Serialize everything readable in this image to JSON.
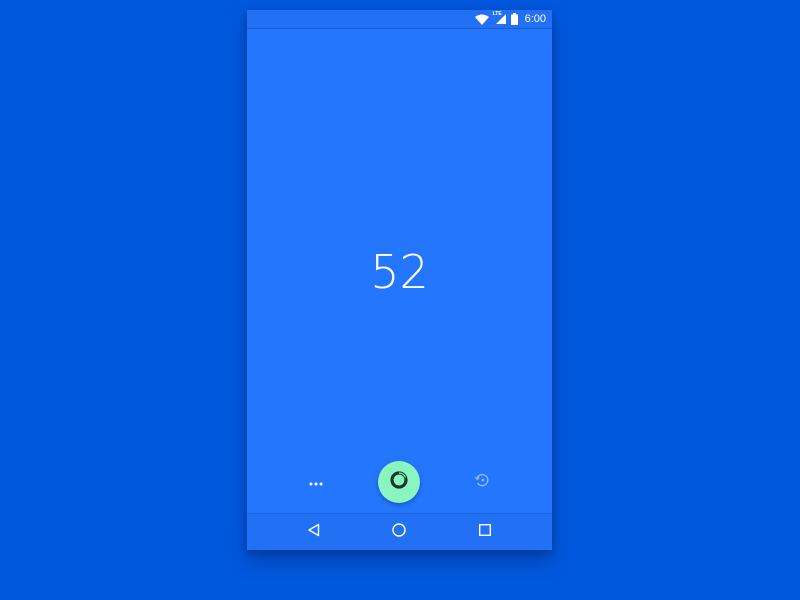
{
  "status_bar": {
    "time": "6:00",
    "network_label": "LTE",
    "icons": [
      "wifi-icon",
      "signal-icon",
      "battery-icon"
    ]
  },
  "main": {
    "counter_value": "52"
  },
  "controls": {
    "icons": [
      "more-dots-icon",
      "progress-ring-icon",
      "reset-icon"
    ]
  },
  "nav_bar": {
    "icons": [
      "back-icon",
      "home-icon",
      "recents-icon"
    ]
  },
  "colors": {
    "background": "#0058DD",
    "screen": "#2576FF",
    "fab": "#8AF5C0",
    "ring": "#0B3A2A"
  }
}
